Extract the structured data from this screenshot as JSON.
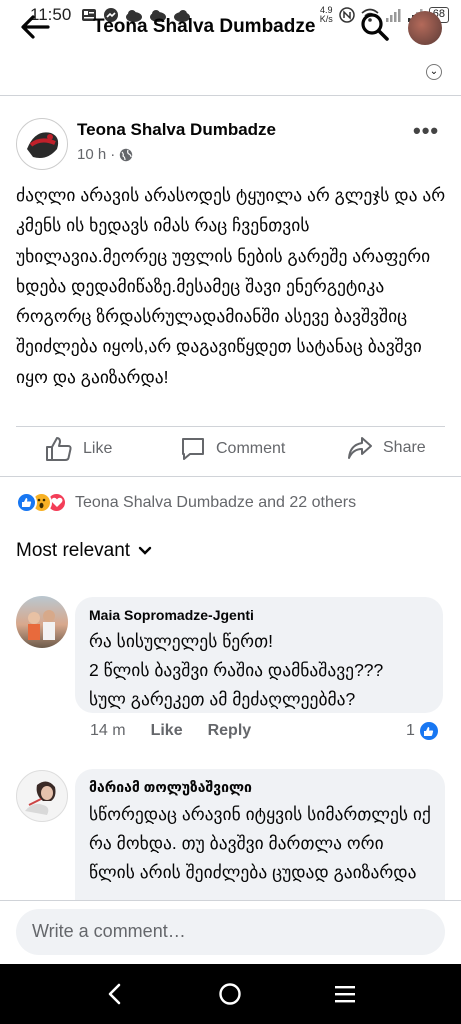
{
  "status_bar": {
    "time": "11:50",
    "network_speed_value": "4.9",
    "network_speed_unit": "K/s",
    "battery": "68"
  },
  "header": {
    "title": "Teona Shalva Dumbadze"
  },
  "post": {
    "author": "Teona Shalva Dumbadze",
    "time": "10 h",
    "separator": "·",
    "text": "ძაღლი არავის არასოდეს ტყუილა არ გლეჯს და არ კმენს ის ხედავს იმას რაც ჩვენთვის უხილავია.მეორეც უფლის ნების გარეშე არაფერი ხდება დედამიწაზე.მესამეც შავი ენერგეტიკა როგორც ზრდასრულადამიანში ასევე ბავშვშიც შეიძლება იყოს,არ დაგავიწყდეთ სატანაც ბავშვი იყო და გაიზარდა!",
    "actions": {
      "like": "Like",
      "comment": "Comment",
      "share": "Share"
    },
    "reactions_text": "Teona Shalva Dumbadze and 22 others"
  },
  "sort": {
    "label": "Most relevant"
  },
  "comments": [
    {
      "name": "Maia Sopromadze-Jgenti",
      "text": "რა სისულელეს წერთ!\n2 წლის ბავშვი რაშია დამნაშავე???\nსულ გარეკეთ ამ მეძაღლეებმა?",
      "time": "14 m",
      "like": "Like",
      "reply": "Reply",
      "reaction_count": "1"
    },
    {
      "name": "მარიამ თოლუზაშვილი",
      "text": "სწორედაც არავინ იტყვის სიმართლეს იქ რა მოხდა.  თუ ბავშვი მართლა ორი წლის არის შეიძლება ცუდად გაიზარდა"
    }
  ],
  "composer": {
    "placeholder": "Write a comment…"
  },
  "colors": {
    "like_blue": "#1877f2",
    "love_red": "#f33e58",
    "haha_yellow": "#f7b125",
    "meta_gray": "#65676b",
    "bubble_bg": "#f0f2f5"
  }
}
